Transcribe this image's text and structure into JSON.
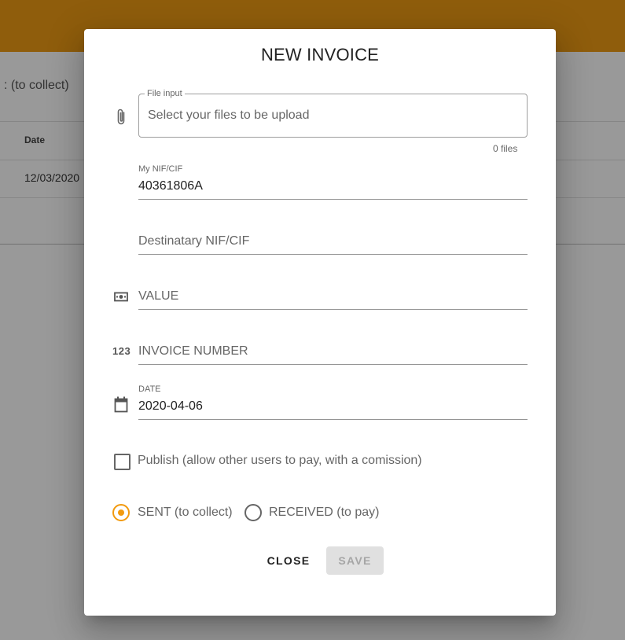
{
  "background": {
    "tab_label": ": (to collect)",
    "table": {
      "header_date": "Date",
      "rows": [
        {
          "date": "12/03/2020"
        }
      ]
    }
  },
  "dialog": {
    "title": "NEW INVOICE",
    "file_input": {
      "label": "File input",
      "placeholder": "Select your files to be upload",
      "count": "0 files",
      "icon": "paperclip-icon"
    },
    "my_nif": {
      "label": "My NIF/CIF",
      "value": "40361806A"
    },
    "destinatary_nif": {
      "placeholder": "Destinatary NIF/CIF"
    },
    "value_field": {
      "placeholder": "VALUE",
      "icon": "money-icon"
    },
    "invoice_number": {
      "placeholder": "INVOICE NUMBER",
      "icon": "numeric-123-icon",
      "icon_text": "123"
    },
    "date": {
      "label": "DATE",
      "value": "2020-04-06",
      "icon": "calendar-icon"
    },
    "publish": {
      "label": "Publish (allow other users to pay, with a comission)",
      "checked": false
    },
    "direction": {
      "options": [
        {
          "label": "SENT (to collect)",
          "selected": true
        },
        {
          "label": "RECEIVED (to pay)",
          "selected": false
        }
      ]
    },
    "buttons": {
      "close": "CLOSE",
      "save": "SAVE"
    }
  },
  "colors": {
    "app_bar": "#ef9b14",
    "accent": "#f29a0e",
    "disabled_button_bg": "#e0e0e0",
    "disabled_button_text": "#a6a6a6"
  }
}
